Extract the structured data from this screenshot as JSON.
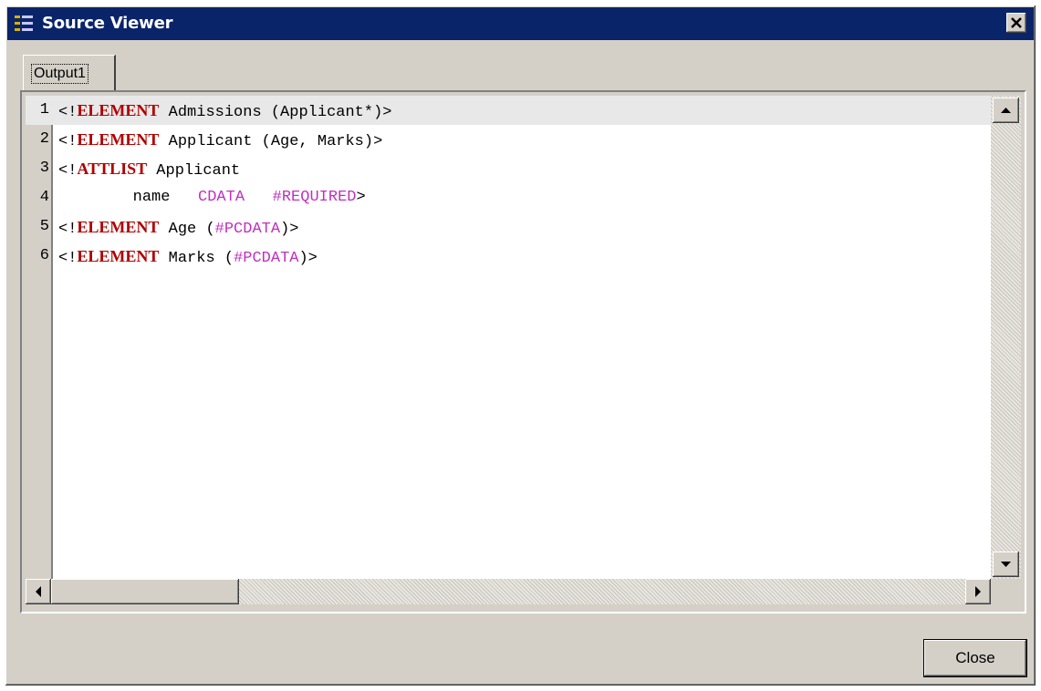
{
  "window": {
    "title": "Source Viewer",
    "icons": {
      "app": "source-viewer-icon",
      "close": "close-icon"
    },
    "colors": {
      "titlebar": "#0a246a",
      "keyword": "#b00000",
      "value": "#c030c0"
    }
  },
  "tabs": [
    {
      "label": "Output1",
      "selected": true
    }
  ],
  "editor": {
    "lines": [
      {
        "number": "1",
        "segments": [
          {
            "text": "<!",
            "style": "plain"
          },
          {
            "text": "ELEMENT",
            "style": "keyword"
          },
          {
            "text": " Admissions (Applicant*)>",
            "style": "plain"
          }
        ]
      },
      {
        "number": "2",
        "segments": [
          {
            "text": "<!",
            "style": "plain"
          },
          {
            "text": "ELEMENT",
            "style": "keyword"
          },
          {
            "text": " Applicant (Age, Marks)>",
            "style": "plain"
          }
        ]
      },
      {
        "number": "3",
        "segments": [
          {
            "text": "<!",
            "style": "plain"
          },
          {
            "text": "ATTLIST",
            "style": "keyword"
          },
          {
            "text": " Applicant",
            "style": "plain"
          }
        ]
      },
      {
        "number": "4",
        "segments": [
          {
            "text": "        name   ",
            "style": "plain"
          },
          {
            "text": "CDATA",
            "style": "value"
          },
          {
            "text": "   ",
            "style": "plain"
          },
          {
            "text": "#REQUIRED",
            "style": "value"
          },
          {
            "text": ">",
            "style": "plain"
          }
        ]
      },
      {
        "number": "5",
        "segments": [
          {
            "text": "<!",
            "style": "plain"
          },
          {
            "text": "ELEMENT",
            "style": "keyword"
          },
          {
            "text": " Age (",
            "style": "plain"
          },
          {
            "text": "#PCDATA",
            "style": "value"
          },
          {
            "text": ")>",
            "style": "plain"
          }
        ]
      },
      {
        "number": "6",
        "segments": [
          {
            "text": "<!",
            "style": "plain"
          },
          {
            "text": "ELEMENT",
            "style": "keyword"
          },
          {
            "text": " Marks (",
            "style": "plain"
          },
          {
            "text": "#PCDATA",
            "style": "value"
          },
          {
            "text": ")>",
            "style": "plain"
          }
        ]
      }
    ]
  },
  "buttons": {
    "close_label": "Close"
  }
}
